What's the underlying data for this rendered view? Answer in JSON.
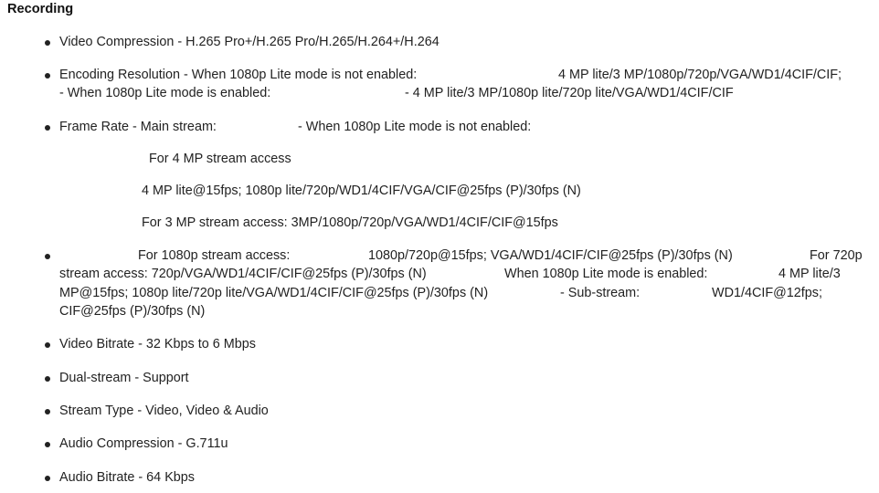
{
  "section": {
    "heading": "Recording"
  },
  "items": {
    "video_compression": "Video Compression - H.265 Pro+/H.265 Pro/H.265/H.264+/H.264",
    "encoding_resolution": {
      "line1_left": "Encoding Resolution - When 1080p Lite mode is not enabled:",
      "line1_right": "4 MP lite/3 MP/1080p/720p/VGA/WD1/4CIF/CIF;",
      "line2_left": "- When 1080p Lite mode is enabled:",
      "line2_right": "- 4 MP lite/3 MP/1080p lite/720p lite/VGA/WD1/4CIF/CIF"
    },
    "frame_rate": {
      "line1_left": "Frame Rate - Main stream:",
      "line1_right": "- When 1080p Lite mode is not enabled:",
      "sub1": "For 4 MP stream access",
      "sub2": "4 MP lite@15fps; 1080p lite/720p/WD1/4CIF/VGA/CIF@25fps (P)/30fps (N)",
      "sub3": "For 3 MP stream access: 3MP/1080p/720p/VGA/WD1/4CIF/CIF@15fps"
    },
    "stream_access": {
      "l1_a": "For 1080p stream access:",
      "l1_b": "1080p/720p@15fps; VGA/WD1/4CIF/CIF@25fps (P)/30fps (N)",
      "l1_c": "For 720p",
      "l2_a": "stream access: 720p/VGA/WD1/4CIF/CIF@25fps (P)/30fps (N)",
      "l2_b": "When 1080p Lite mode is enabled:",
      "l2_c": "4 MP lite/3",
      "l3_a": "MP@15fps; 1080p lite/720p lite/VGA/WD1/4CIF/CIF@25fps (P)/30fps (N)",
      "l3_b": "- Sub-stream:",
      "l3_c": "WD1/4CIF@12fps;",
      "l4_a": "CIF@25fps (P)/30fps (N)"
    },
    "video_bitrate": "Video Bitrate - 32 Kbps to 6 Mbps",
    "dual_stream": "Dual-stream - Support",
    "stream_type": "Stream Type - Video, Video & Audio",
    "audio_compression": "Audio Compression - G.711u",
    "audio_bitrate": "Audio Bitrate - 64 Kbps"
  }
}
